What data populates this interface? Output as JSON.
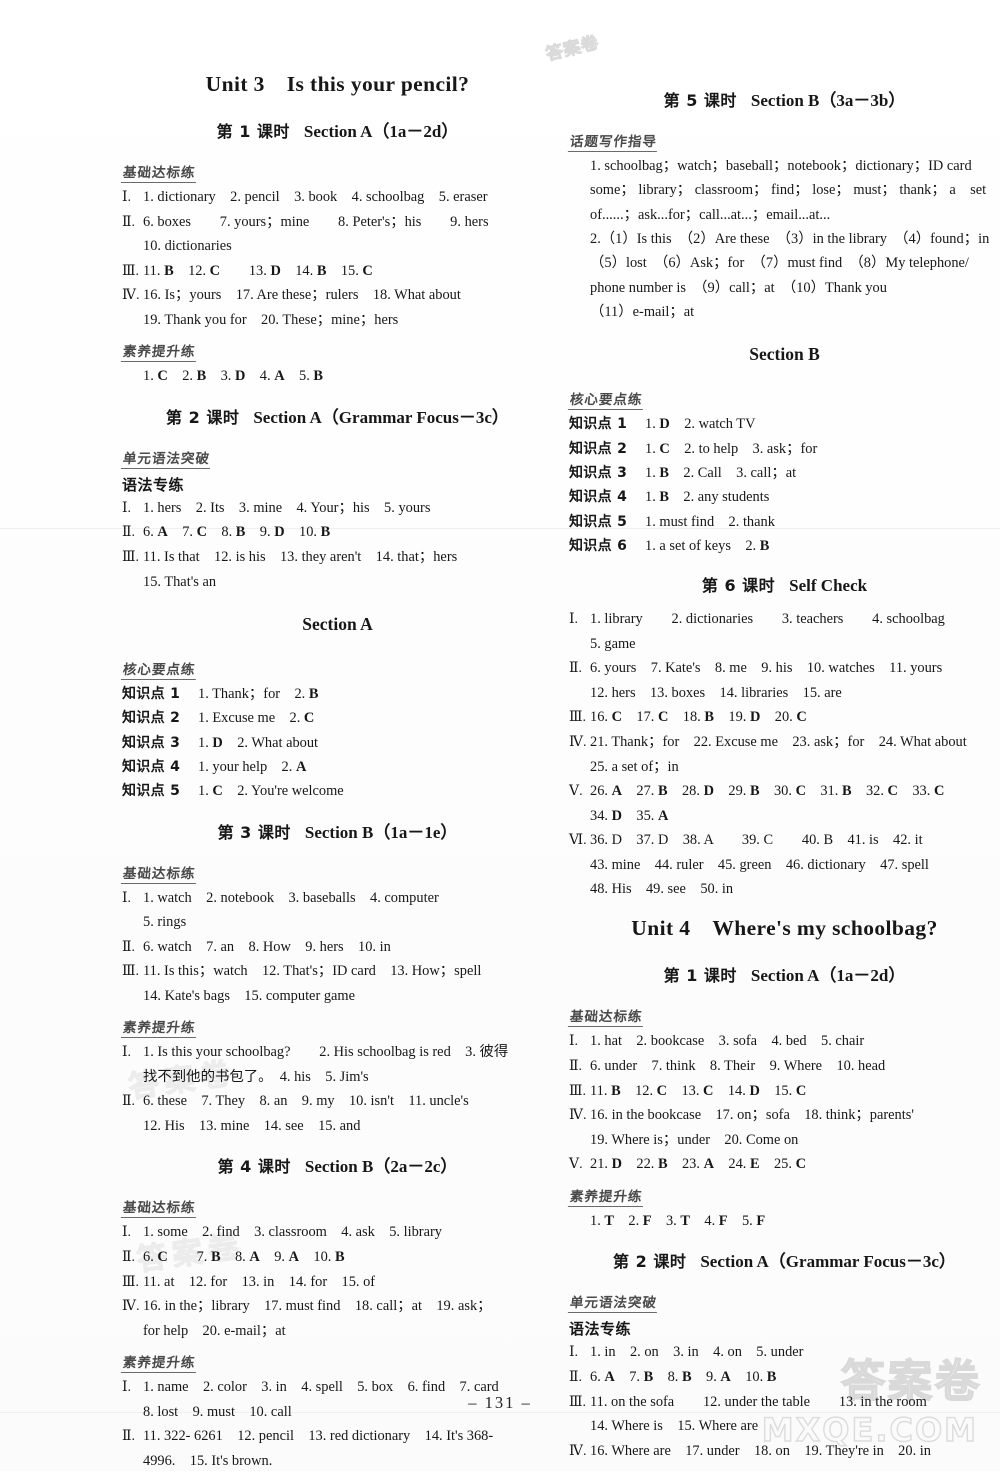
{
  "page": {
    "number": "– 131 –",
    "watermark_cn": "答案卷",
    "watermark_url": "MXQE.COM",
    "watermark_top": "答案卷",
    "watermark_faint_1": "答案卷",
    "watermark_faint_2": "答案卷"
  },
  "labels": {
    "basic": "基础达标练",
    "literacy": "素养提升练",
    "core": "核心要点练",
    "grammar_breakthrough": "单元语法突破",
    "grammar_drill": "语法专练",
    "writing_guide": "话题写作指导"
  },
  "left_column": {
    "unit_title": {
      "unit": "Unit 3",
      "name": "Is this your pencil?"
    },
    "lessons": [
      {
        "cn": "第 1 课时",
        "en": "Section A（1a－2d）",
        "blocks": [
          {
            "label": "基础达标练",
            "lines": [
              {
                "rn": "Ⅰ.",
                "text": "1. dictionary　2. pencil　3. book　4. schoolbag　5. eraser"
              },
              {
                "rn": "Ⅱ.",
                "text": "6. boxes　　7. yours；mine　　8. Peter's；his　　9. hers"
              },
              {
                "rn": "",
                "text": "10. dictionaries"
              },
              {
                "rn": "Ⅲ.",
                "text": "11. B　12. C　　13. D　14. B　15. C",
                "bold_answers": true
              },
              {
                "rn": "Ⅳ.",
                "text": "16. Is；yours　17. Are these；rulers　18. What about"
              },
              {
                "rn": "",
                "text": "19. Thank you for　20. These；mine；hers"
              }
            ]
          },
          {
            "label": "素养提升练",
            "lines": [
              {
                "rn": "",
                "text": "1. C　2. B　3. D　4. A　5. B",
                "bold_answers": true
              }
            ]
          }
        ]
      },
      {
        "cn": "第 2 课时",
        "en": "Section A（Grammar Focus－3c）",
        "blocks": [
          {
            "label": "单元语法突破",
            "sub": "语法专练",
            "lines": [
              {
                "rn": "Ⅰ.",
                "text": "1. hers　2. Its　3. mine　4. Your；his　5. yours"
              },
              {
                "rn": "Ⅱ.",
                "text": "6. A　7. C　8. B　9. D　10. B",
                "bold_answers": true
              },
              {
                "rn": "Ⅲ.",
                "text": "11. Is that　12. is his　13. they aren't　14. that；hers"
              },
              {
                "rn": "",
                "text": "15. That's an"
              }
            ]
          }
        ],
        "section_heading": "Section A",
        "section_blocks": [
          {
            "label": "核心要点练",
            "kp_lines": [
              {
                "kp": "知识点 1",
                "text": "1. Thank；for　2. B"
              },
              {
                "kp": "知识点 2",
                "text": "1. Excuse me　2. C"
              },
              {
                "kp": "知识点 3",
                "text": "1. D　2. What about"
              },
              {
                "kp": "知识点 4",
                "text": "1. your help　2. A"
              },
              {
                "kp": "知识点 5",
                "text": "1. C　2. You're welcome"
              }
            ]
          }
        ]
      },
      {
        "cn": "第 3 课时",
        "en": "Section B（1a－1e）",
        "blocks": [
          {
            "label": "基础达标练",
            "lines": [
              {
                "rn": "Ⅰ.",
                "text": "1. watch　2. notebook　3. baseballs　4. computer"
              },
              {
                "rn": "",
                "text": "5. rings"
              },
              {
                "rn": "Ⅱ.",
                "text": "6. watch　7. an　8. How　9. hers　10. in"
              },
              {
                "rn": "Ⅲ.",
                "text": "11. Is this；watch　12. That's；ID card　13. How；spell"
              },
              {
                "rn": "",
                "text": "14. Kate's bags　15. computer game"
              }
            ]
          },
          {
            "label": "素养提升练",
            "lines": [
              {
                "rn": "Ⅰ.",
                "text": "1. Is this your schoolbag?　　2. His schoolbag is red　3. 彼得"
              },
              {
                "rn": "",
                "text": "找不到他的书包了。　4. his　5. Jim's"
              },
              {
                "rn": "Ⅱ.",
                "text": "6. these　7. They　8. an　9. my　10. isn't　11. uncle's"
              },
              {
                "rn": "",
                "text": "12. His　13. mine　14. see　15. and"
              }
            ]
          }
        ]
      },
      {
        "cn": "第 4 课时",
        "en": "Section B（2a－2c）",
        "blocks": [
          {
            "label": "基础达标练",
            "lines": [
              {
                "rn": "Ⅰ.",
                "text": "1. some　2. find　3. classroom　4. ask　5. library"
              },
              {
                "rn": "Ⅱ.",
                "text": "6. C　　7. B　8. A　9. A　10. B",
                "bold_answers": true
              },
              {
                "rn": "Ⅲ.",
                "text": "11. at　12. for　13. in　14. for　15. of"
              },
              {
                "rn": "Ⅳ.",
                "text": "16. in the；library　17. must find　18. call；at　19. ask；"
              },
              {
                "rn": "",
                "text": "for help　20. e-mail；at"
              }
            ]
          },
          {
            "label": "素养提升练",
            "lines": [
              {
                "rn": "Ⅰ.",
                "text": "1. name　2. color　3. in　4. spell　5. box　6. find　7. card"
              },
              {
                "rn": "",
                "text": "8. lost　9. must　10. call"
              },
              {
                "rn": "Ⅱ.",
                "text": "11. 322- 6261　12. pencil　13. red dictionary　14. It's 368-"
              },
              {
                "rn": "",
                "text": "4996.　15. It's brown."
              }
            ]
          }
        ]
      }
    ]
  },
  "right_column": {
    "lessons": [
      {
        "cn": "第 5 课时",
        "en": "Section B（3a－3b）",
        "blocks": [
          {
            "label": "话题写作指导",
            "lines": [
              {
                "rn": "",
                "text": "1. schoolbag；watch；baseball；notebook；dictionary；ID card"
              },
              {
                "rn": "",
                "text": "some； library； classroom； find； lose； must； thank； a　set"
              },
              {
                "rn": "",
                "text": "of......；ask...for；call...at...；email...at..."
              },
              {
                "rn": "",
                "text": "2.（1）Is this　（2）Are these　（3）in the library　（4）found；in"
              },
              {
                "rn": "",
                "text": "（5）lost　（6）Ask；for　（7）must find　（8）My telephone/"
              },
              {
                "rn": "",
                "text": "phone number is　（9）call；at　（10）Thank you"
              },
              {
                "rn": "",
                "text": "（11）e-mail；at"
              }
            ]
          }
        ],
        "section_heading": "Section B",
        "section_blocks": [
          {
            "label": "核心要点练",
            "kp_lines": [
              {
                "kp": "知识点 1",
                "text": "1. D　2. watch TV"
              },
              {
                "kp": "知识点 2",
                "text": "1. C　2. to help　3. ask；for"
              },
              {
                "kp": "知识点 3",
                "text": "1. B　2. Call　3. call；at"
              },
              {
                "kp": "知识点 4",
                "text": "1. B　2. any students"
              },
              {
                "kp": "知识点 5",
                "text": "1. must find　2. thank"
              },
              {
                "kp": "知识点 6",
                "text": "1. a set of keys　2. B"
              }
            ]
          }
        ]
      },
      {
        "cn": "第 6 课时",
        "en": "Self Check",
        "blocks": [
          {
            "label": "",
            "lines": [
              {
                "rn": "Ⅰ.",
                "text": "1. library　　2. dictionaries　　3. teachers　　4. schoolbag"
              },
              {
                "rn": "",
                "text": "5. game"
              },
              {
                "rn": "Ⅱ.",
                "text": "6. yours　7. Kate's　8. me　9. his　10. watches　11. yours"
              },
              {
                "rn": "",
                "text": "12. hers　13. boxes　14. libraries　15. are"
              },
              {
                "rn": "Ⅲ.",
                "text": "16. C　17. C　18. B　19. D　20. C",
                "bold_answers": true
              },
              {
                "rn": "Ⅳ.",
                "text": "21. Thank；for　22. Excuse me　23. ask；for　24. What about"
              },
              {
                "rn": "",
                "text": "25. a set of；in"
              },
              {
                "rn": "Ⅴ.",
                "text": "26. A　27. B　28. D　29. B　30. C　31. B　32. C　33. C",
                "bold_answers": true
              },
              {
                "rn": "",
                "text": "34. D　35. A",
                "bold_answers": true
              },
              {
                "rn": "Ⅵ.",
                "text": "36. D　37. D　38. A　　39. C　　40. B　41. is　42. it"
              },
              {
                "rn": "",
                "text": "43. mine　44. ruler　45. green　46. dictionary　47. spell"
              },
              {
                "rn": "",
                "text": "48. His　49. see　50. in"
              }
            ]
          }
        ]
      }
    ],
    "unit_title": {
      "unit": "Unit 4",
      "name": "Where's my schoolbag?"
    },
    "unit4_lessons": [
      {
        "cn": "第 1 课时",
        "en": "Section A（1a－2d）",
        "blocks": [
          {
            "label": "基础达标练",
            "lines": [
              {
                "rn": "Ⅰ.",
                "text": "1. hat　2. bookcase　3. sofa　4. bed　5. chair"
              },
              {
                "rn": "Ⅱ.",
                "text": "6. under　7. think　8. Their　9. Where　10. head"
              },
              {
                "rn": "Ⅲ.",
                "text": "11. B　12. C　13. C　14. D　15. C",
                "bold_answers": true
              },
              {
                "rn": "Ⅳ.",
                "text": "16. in the bookcase　17. on；sofa　18. think；parents'"
              },
              {
                "rn": "",
                "text": "19. Where is；under　20. Come on"
              },
              {
                "rn": "Ⅴ.",
                "text": "21. D　22. B　23. A　24. E　25. C",
                "bold_answers": true
              }
            ]
          },
          {
            "label": "素养提升练",
            "lines": [
              {
                "rn": "",
                "text": "1. T　2. F　3. T　4. F　5. F",
                "bold_answers": true
              }
            ]
          }
        ]
      },
      {
        "cn": "第 2 课时",
        "en": "Section A（Grammar Focus－3c）",
        "blocks": [
          {
            "label": "单元语法突破",
            "sub": "语法专练",
            "lines": [
              {
                "rn": "Ⅰ.",
                "text": "1. in　2. on　3. in　4. on　5. under"
              },
              {
                "rn": "Ⅱ.",
                "text": "6. A　7. B　8. B　9. A　10. B",
                "bold_answers": true
              },
              {
                "rn": "Ⅲ.",
                "text": "11. on the sofa　　12. under the table　　13. in the room"
              },
              {
                "rn": "",
                "text": "14. Where is　15. Where are"
              },
              {
                "rn": "Ⅳ.",
                "text": "16. Where are　17. under　18. on　19. They're in　20. in"
              }
            ]
          }
        ]
      }
    ]
  }
}
